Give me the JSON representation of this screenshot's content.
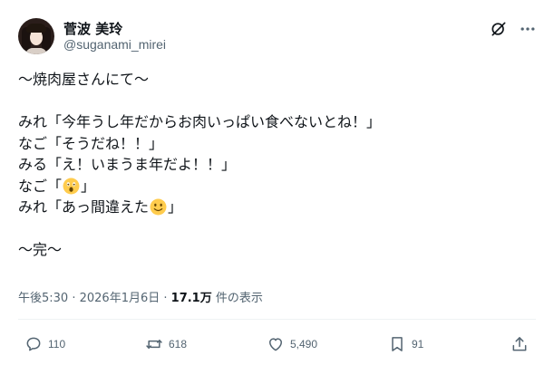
{
  "author": {
    "display_name": "菅波 美玲",
    "handle": "@suganami_mirei"
  },
  "icons": {
    "grok": "grok-icon",
    "more": "more-icon",
    "reply": "reply-icon",
    "repost": "repost-icon",
    "like": "heart-icon",
    "bookmark": "bookmark-icon",
    "share": "share-icon"
  },
  "tweet": {
    "lines": [
      "〜焼肉屋さんにて〜",
      "",
      "みれ「今年うし年だからお肉いっぱい食べないとね！」",
      "なご「そうだね！！」",
      "みる「え！いまうま年だよ！！」",
      "なご「",
      "」",
      "みれ「あっ間違えた",
      "」",
      "",
      "〜完〜"
    ]
  },
  "meta": {
    "time": "午後5:30",
    "separator1": " · ",
    "date": "2026年1月6日",
    "separator2": " · ",
    "views_count": "17.1万",
    "views_label": " 件の表示"
  },
  "actions": {
    "reply_count": "110",
    "repost_count": "618",
    "like_count": "5,490",
    "bookmark_count": "91"
  },
  "colors": {
    "text": "#0f1419",
    "secondary": "#536471",
    "divider": "#eff3f4",
    "emoji_yellow": "#ffcc4d"
  }
}
